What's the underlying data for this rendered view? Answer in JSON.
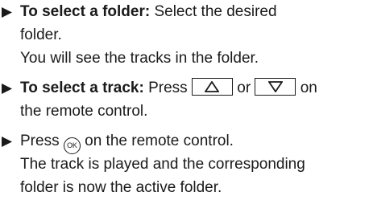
{
  "instructions": [
    {
      "icon": "bullet-arrow-icon",
      "lead": "To select a folder:",
      "lines": [
        " Select the desired",
        "folder.",
        "You will see the tracks in the folder."
      ]
    },
    {
      "icon": "bullet-arrow-icon",
      "lead": "To select a track:",
      "text_press": " Press",
      "up_key_icon": "triangle-up-key-icon",
      "text_or": "or",
      "down_key_icon": "triangle-down-key-icon",
      "text_on": "on",
      "line2": "the remote control."
    },
    {
      "icon": "bullet-arrow-icon",
      "text_press": "Press",
      "ok_label": "OK",
      "text_after_ok": " on the remote control.",
      "lines": [
        "The track is played and the corresponding",
        "folder is now the active folder."
      ]
    }
  ]
}
